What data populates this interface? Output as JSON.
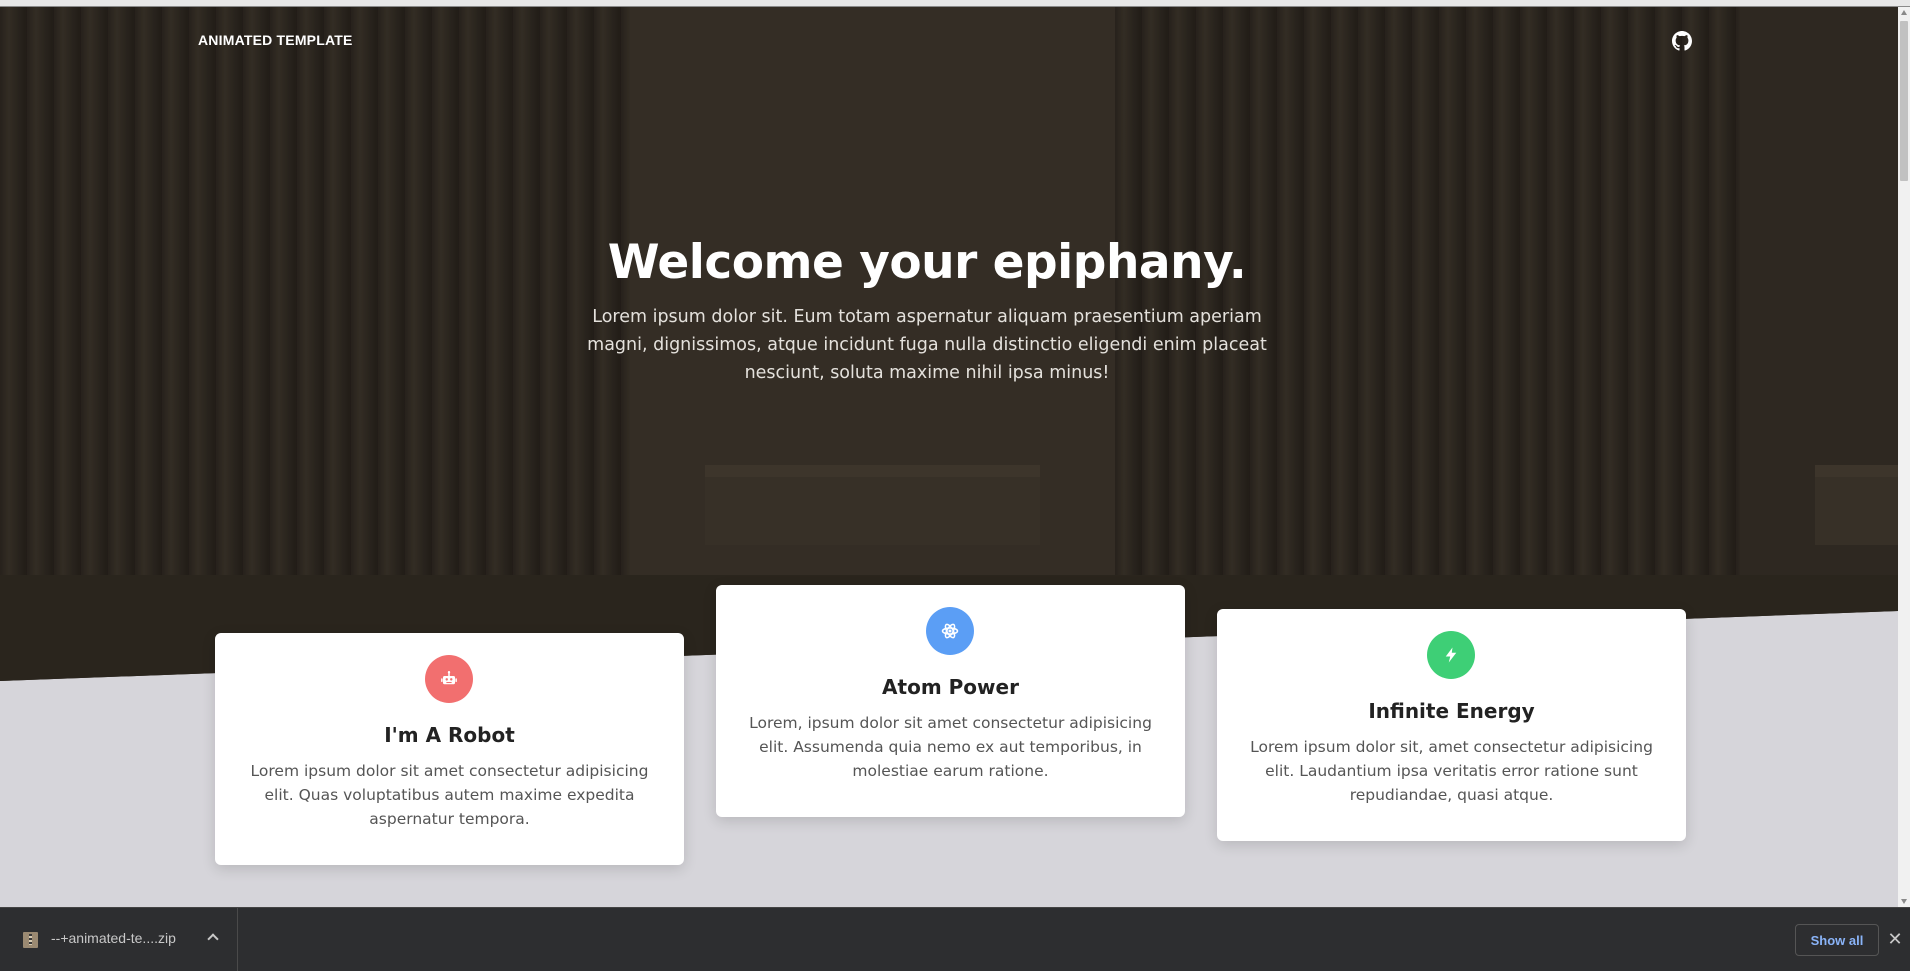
{
  "header": {
    "brand": "ANIMATED TEMPLATE",
    "github_icon": "github-icon"
  },
  "hero": {
    "title": "Welcome your epiphany.",
    "text": "Lorem ipsum dolor sit. Eum totam aspernatur aliquam praesentium aperiam magni, dignissimos, atque incidunt fuga nulla distinctio eligendi enim placeat nesciunt, soluta maxime nihil ipsa minus!"
  },
  "cards": [
    {
      "icon": "robot-icon",
      "color": "#f26f6f",
      "title": "I'm A Robot",
      "text": "Lorem ipsum dolor sit amet consectetur adipisicing elit. Quas voluptatibus autem maxime expedita aspernatur tempora."
    },
    {
      "icon": "atom-icon",
      "color": "#5b9ef5",
      "title": "Atom Power",
      "text": "Lorem, ipsum dolor sit amet consectetur adipisicing elit. Assumenda quia nemo ex aut temporibus, in molestiae earum ratione."
    },
    {
      "icon": "bolt-icon",
      "color": "#3ecf76",
      "title": "Infinite Energy",
      "text": "Lorem ipsum dolor sit, amet consectetur adipisicing elit. Laudantium ipsa veritatis error ratione sunt repudiandae, quasi atque."
    }
  ],
  "downloads": {
    "file_name": "--+animated-te....zip",
    "show_all": "Show all",
    "close": "✕"
  }
}
